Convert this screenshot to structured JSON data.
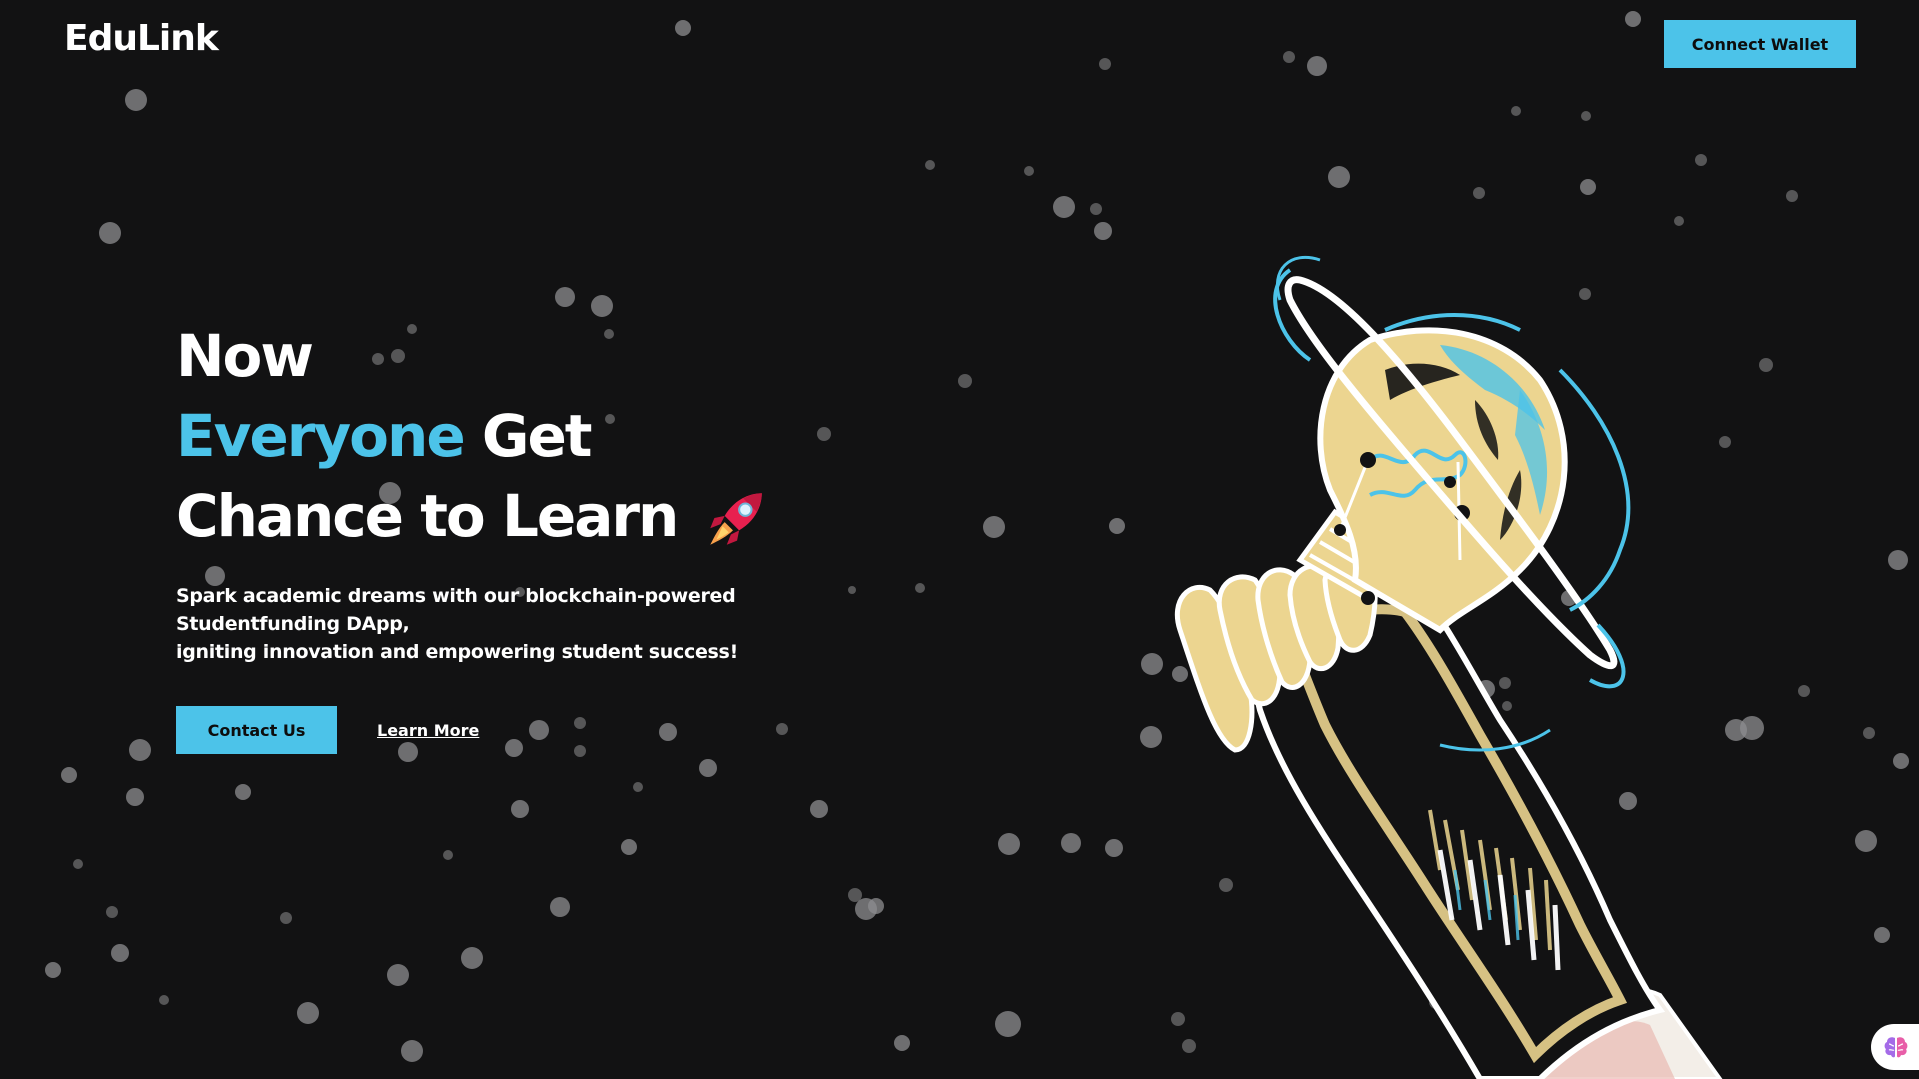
{
  "header": {
    "logo_text": "EduLink",
    "connect_button_label": "Connect Wallet"
  },
  "hero": {
    "line1": "Now",
    "line2_accent": "Everyone",
    "line2_rest": " Get",
    "line3": "Chance to Learn",
    "rocket_icon": "rocket-icon",
    "subtitle_line1": "Spark academic dreams with our blockchain-powered Studentfunding DApp,",
    "subtitle_line2": "igniting innovation and empowering student success!",
    "contact_button_label": "Contact Us",
    "learn_more_label": "Learn More"
  },
  "illustration": {
    "icon": "hand-holding-lightbulb-planet-illustration"
  },
  "floating_widget": {
    "icon": "brain-icon"
  },
  "colors": {
    "background": "#121213",
    "accent": "#4cc3e9",
    "text": "#ffffff",
    "bulb": "#ecd590"
  }
}
